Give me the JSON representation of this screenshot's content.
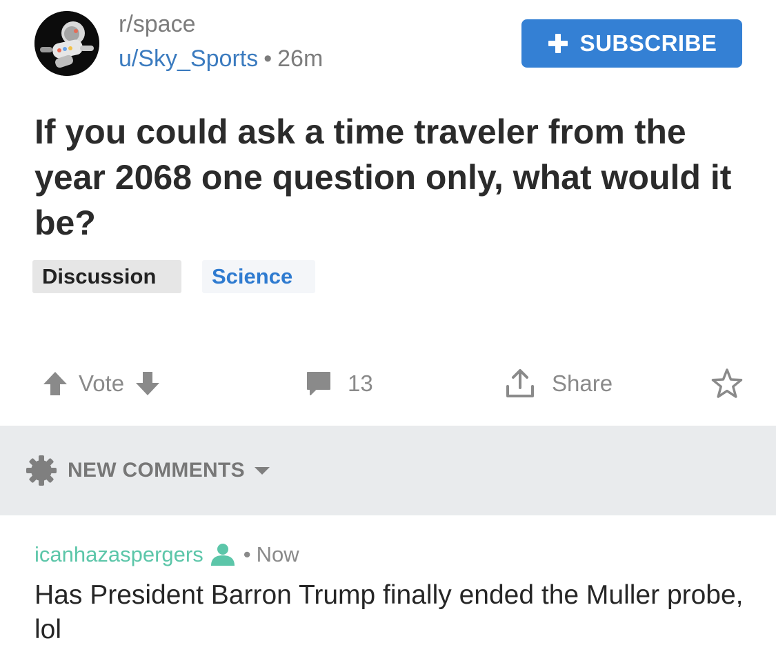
{
  "header": {
    "subreddit": "r/space",
    "author": "u/Sky_Sports",
    "separator": "•",
    "age": "26m",
    "subscribe_label": "SUBSCRIBE"
  },
  "post": {
    "title": "If you could ask a time traveler from the year 2068 one question only, what would it be?",
    "flairs": [
      "Discussion",
      "Science"
    ]
  },
  "actions": {
    "vote_label": "Vote",
    "comment_count": "13",
    "share_label": "Share"
  },
  "sort": {
    "label": "NEW COMMENTS"
  },
  "comment": {
    "author": "icanhazaspergers",
    "separator": "•",
    "age": "Now",
    "body": "Has President Barron Trump finally ended the Muller probe, lol"
  },
  "colors": {
    "accent_blue": "#3480d4",
    "author_blue": "#3b7bbf",
    "commenter_green": "#5cc6a9",
    "muted_gray": "#8a8a8a",
    "sort_bar_bg": "#e9ebed"
  },
  "icons": {
    "avatar": "astronaut-avatar",
    "subscribe": "plus-icon",
    "upvote": "arrow-up-icon",
    "downvote": "arrow-down-icon",
    "comments": "speech-bubble-icon",
    "share": "share-icon",
    "save": "star-icon",
    "sort": "gear-icon",
    "sort_dropdown": "caret-down-icon",
    "op_badge": "person-icon"
  }
}
